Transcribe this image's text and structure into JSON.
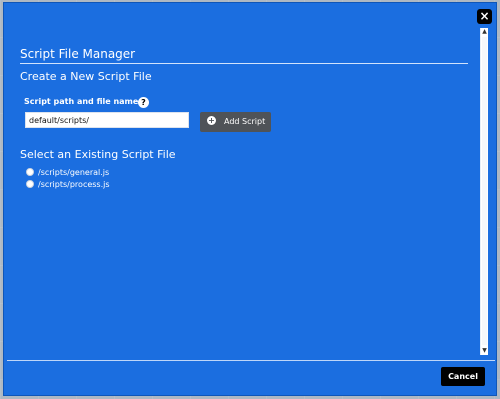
{
  "dialog": {
    "title": "Script File Manager",
    "subtitle": "Create a New Script File",
    "field_label": "Script path and file name:",
    "help_icon": "?",
    "input_value": "default/scripts/",
    "add_button_label": "Add Script",
    "existing_title": "Select an Existing Script File",
    "files": [
      "/scripts/general.js",
      "/scripts/process.js"
    ],
    "cancel_label": "Cancel",
    "close_label": "×",
    "colors": {
      "dialog_bg": "#1b6ee0",
      "button_dark": "#4f5358",
      "black": "#000000",
      "white": "#ffffff"
    },
    "icons": {
      "close": "close-icon",
      "help": "help-icon",
      "add": "plus-circle-icon",
      "scroll_up": "arrow-up-icon",
      "scroll_down": "arrow-down-icon"
    }
  }
}
